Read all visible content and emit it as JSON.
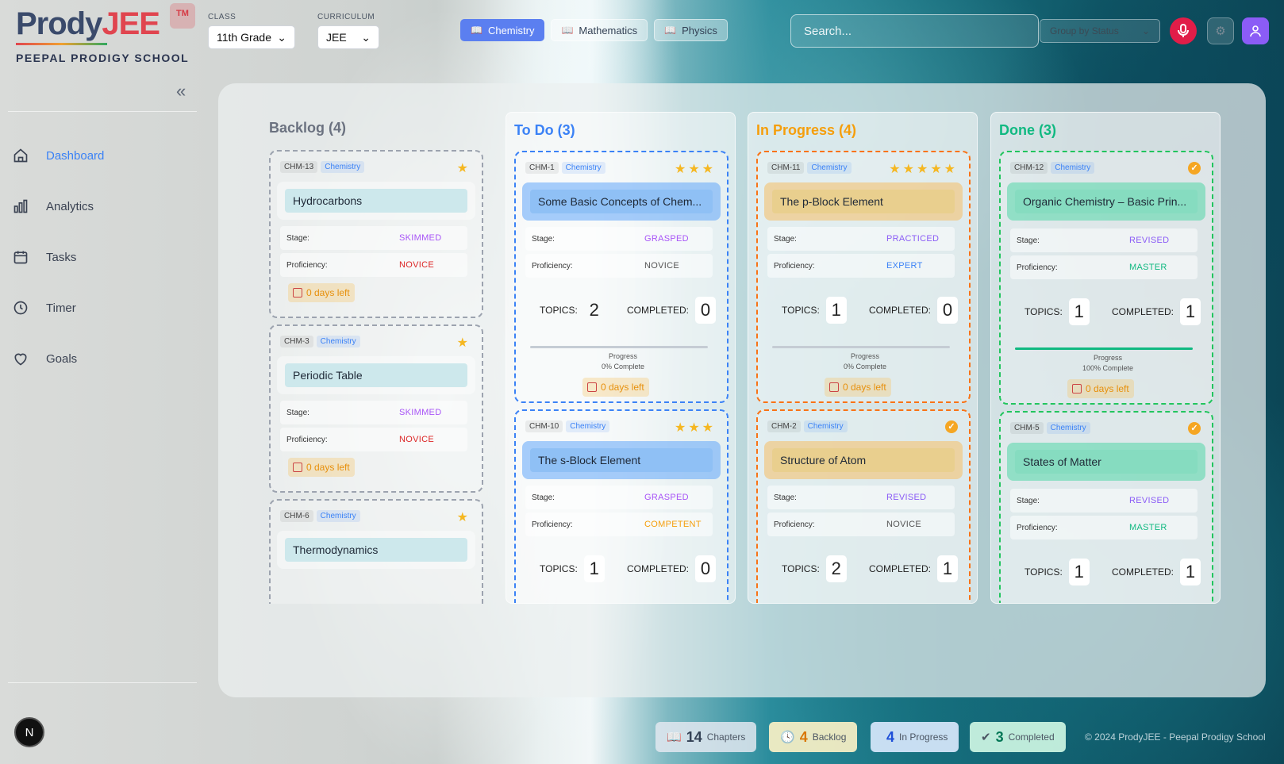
{
  "brand": {
    "prody": "Prody",
    "jee": "JEE",
    "tm": "TM",
    "school": "PEEPAL PRODIGY SCHOOL"
  },
  "filters": {
    "class_label": "CLASS",
    "class_value": "11th Grade",
    "curriculum_label": "CURRICULUM",
    "curriculum_value": "JEE"
  },
  "tabs": [
    {
      "label": "Chemistry",
      "active": true
    },
    {
      "label": "Mathematics",
      "active": false
    },
    {
      "label": "Physics",
      "active": false
    }
  ],
  "search": {
    "placeholder": "Search..."
  },
  "group_by": "Group by Status",
  "sidebar": {
    "items": [
      {
        "label": "Dashboard",
        "icon": "home-icon",
        "active": true
      },
      {
        "label": "Analytics",
        "icon": "bar-chart-icon",
        "active": false
      },
      {
        "label": "Tasks",
        "icon": "calendar-icon",
        "active": false
      },
      {
        "label": "Timer",
        "icon": "clock-icon",
        "active": false
      },
      {
        "label": "Goals",
        "icon": "heart-icon",
        "active": false
      }
    ],
    "user_initial": "N"
  },
  "columns": [
    {
      "title": "Backlog (4)",
      "color": "#6b7280",
      "cards": [
        {
          "id": "CHM-13",
          "subject": "Chemistry",
          "name": "Hydrocarbons",
          "stars": 1,
          "stage": "SKIMMED",
          "proficiency": "NOVICE",
          "days": "0 days left"
        },
        {
          "id": "CHM-3",
          "subject": "Chemistry",
          "name": "Periodic Table",
          "stars": 1,
          "stage": "SKIMMED",
          "proficiency": "NOVICE",
          "days": "0 days left"
        },
        {
          "id": "CHM-6",
          "subject": "Chemistry",
          "name": "Thermodynamics",
          "stars": 1
        }
      ]
    },
    {
      "title": "To Do (3)",
      "color": "#3b82f6",
      "cards": [
        {
          "id": "CHM-1",
          "subject": "Chemistry",
          "name": "Some Basic Concepts of Chem...",
          "stars": 3,
          "stage": "GRASPED",
          "proficiency": "NOVICE",
          "topics": "2",
          "completed": "0",
          "progress_label": "Progress",
          "progress_text": "0% Complete",
          "progress": 0,
          "days": "0 days left"
        },
        {
          "id": "CHM-10",
          "subject": "Chemistry",
          "name": "The s-Block Element",
          "stars": 3,
          "stage": "GRASPED",
          "proficiency": "COMPETENT",
          "topics": "1",
          "completed": "0"
        }
      ]
    },
    {
      "title": "In Progress (4)",
      "color": "#f59e0b",
      "cards": [
        {
          "id": "CHM-11",
          "subject": "Chemistry",
          "name": "The p-Block Element",
          "stars": 5,
          "stage": "PRACTICED",
          "proficiency": "EXPERT",
          "topics": "1",
          "completed": "0",
          "progress_label": "Progress",
          "progress_text": "0% Complete",
          "progress": 0,
          "days": "0 days left"
        },
        {
          "id": "CHM-2",
          "subject": "Chemistry",
          "name": "Structure of Atom",
          "done": true,
          "stage": "REVISED",
          "proficiency": "NOVICE",
          "topics": "2",
          "completed": "1"
        }
      ]
    },
    {
      "title": "Done (3)",
      "color": "#10b981",
      "cards": [
        {
          "id": "CHM-12",
          "subject": "Chemistry",
          "name": "Organic Chemistry – Basic Prin...",
          "done": true,
          "stage": "REVISED",
          "proficiency": "MASTER",
          "topics": "1",
          "completed": "1",
          "progress_label": "Progress",
          "progress_text": "100% Complete",
          "progress": 1,
          "days": "0 days left"
        },
        {
          "id": "CHM-5",
          "subject": "Chemistry",
          "name": "States of Matter",
          "done": true,
          "stage": "REVISED",
          "proficiency": "MASTER",
          "topics": "1",
          "completed": "1"
        }
      ]
    }
  ],
  "labels": {
    "stage": "Stage:",
    "proficiency": "Proficiency:",
    "topics": "TOPICS:",
    "completed": "COMPLETED:"
  },
  "footer": {
    "chapters": {
      "n": "14",
      "label": "Chapters"
    },
    "backlog": {
      "n": "4",
      "label": "Backlog"
    },
    "in_progress": {
      "n": "4",
      "label": "In Progress"
    },
    "completed": {
      "n": "3",
      "label": "Completed"
    },
    "copyright": "© 2024 ProdyJEE - Peepal Prodigy School"
  },
  "colors": {
    "stage_skimmed": "#a855f7",
    "stage_grasped": "#a855f7",
    "stage_practiced": "#8b5cf6",
    "stage_revised": "#8b5cf6",
    "prof_novice": "#dc2626",
    "prof_expert": "#3b82f6",
    "prof_competent": "#f59e0b",
    "prof_master": "#10b981"
  }
}
